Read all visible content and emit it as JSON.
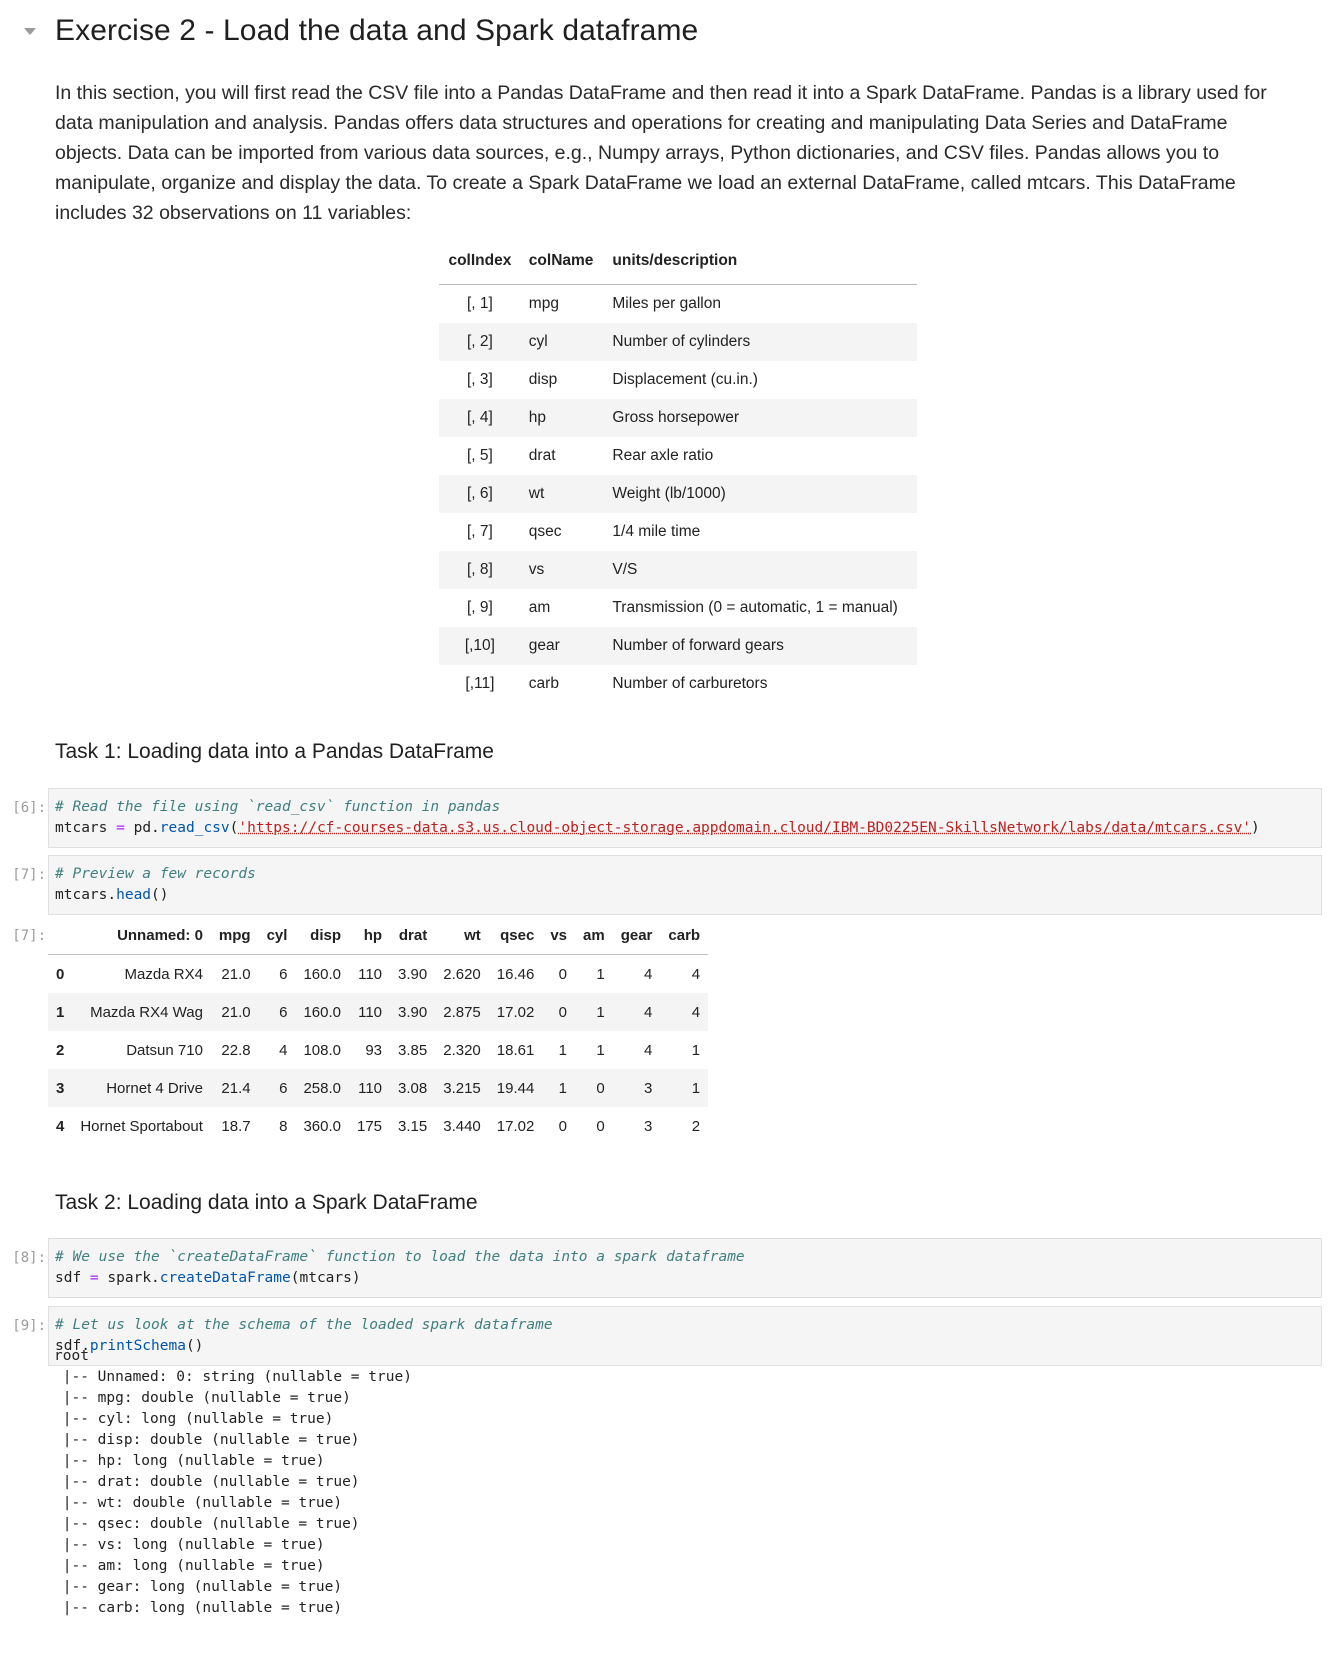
{
  "section": {
    "title": "Exercise 2 - Load the data and Spark dataframe",
    "intro": "In this section, you will first read the CSV file into a Pandas DataFrame and then read it into a Spark DataFrame. Pandas is a library used for data manipulation and analysis. Pandas offers data structures and operations for creating and manipulating Data Series and DataFrame objects. Data can be imported from various data sources, e.g., Numpy arrays, Python dictionaries, and CSV files. Pandas allows you to manipulate, organize and display the data. To create a Spark DataFrame we load an external DataFrame, called mtcars. This DataFrame includes 32 observations on 11 variables:"
  },
  "vars_table": {
    "headers": [
      "colIndex",
      "colName",
      "units/description"
    ],
    "rows": [
      [
        "[, 1]",
        "mpg",
        "Miles per gallon"
      ],
      [
        "[, 2]",
        "cyl",
        "Number of cylinders"
      ],
      [
        "[, 3]",
        "disp",
        "Displacement (cu.in.)"
      ],
      [
        "[, 4]",
        "hp",
        "Gross horsepower"
      ],
      [
        "[, 5]",
        "drat",
        "Rear axle ratio"
      ],
      [
        "[, 6]",
        "wt",
        "Weight (lb/1000)"
      ],
      [
        "[, 7]",
        "qsec",
        "1/4 mile time"
      ],
      [
        "[, 8]",
        "vs",
        "V/S"
      ],
      [
        "[, 9]",
        "am",
        "Transmission (0 = automatic, 1 = manual)"
      ],
      [
        "[,10]",
        "gear",
        "Number of forward gears"
      ],
      [
        "[,11]",
        "carb",
        "Number of carburetors"
      ]
    ]
  },
  "task1": {
    "title": "Task 1: Loading data into a Pandas DataFrame",
    "cell6": {
      "prompt": "[6]:",
      "comment": "# Read the file using `read_csv` function in pandas",
      "var": "mtcars",
      "op": " = ",
      "obj": "pd.",
      "fn": "read_csv",
      "open": "(",
      "url": "'https://cf-courses-data.s3.us.cloud-object-storage.appdomain.cloud/IBM-BD0225EN-SkillsNetwork/labs/data/mtcars.csv'",
      "close": ")"
    },
    "cell7": {
      "prompt": "[7]:",
      "comment": "# Preview a few records",
      "obj": "mtcars.",
      "fn": "head",
      "call": "()"
    },
    "output7": {
      "prompt": "[7]:",
      "headers": [
        "",
        "Unnamed: 0",
        "mpg",
        "cyl",
        "disp",
        "hp",
        "drat",
        "wt",
        "qsec",
        "vs",
        "am",
        "gear",
        "carb"
      ],
      "rows": [
        [
          "0",
          "Mazda RX4",
          "21.0",
          "6",
          "160.0",
          "110",
          "3.90",
          "2.620",
          "16.46",
          "0",
          "1",
          "4",
          "4"
        ],
        [
          "1",
          "Mazda RX4 Wag",
          "21.0",
          "6",
          "160.0",
          "110",
          "3.90",
          "2.875",
          "17.02",
          "0",
          "1",
          "4",
          "4"
        ],
        [
          "2",
          "Datsun 710",
          "22.8",
          "4",
          "108.0",
          "93",
          "3.85",
          "2.320",
          "18.61",
          "1",
          "1",
          "4",
          "1"
        ],
        [
          "3",
          "Hornet 4 Drive",
          "21.4",
          "6",
          "258.0",
          "110",
          "3.08",
          "3.215",
          "19.44",
          "1",
          "0",
          "3",
          "1"
        ],
        [
          "4",
          "Hornet Sportabout",
          "18.7",
          "8",
          "360.0",
          "175",
          "3.15",
          "3.440",
          "17.02",
          "0",
          "0",
          "3",
          "2"
        ]
      ]
    }
  },
  "task2": {
    "title": "Task 2: Loading data into a Spark DataFrame",
    "cell8": {
      "prompt": "[8]:",
      "comment": "# We use the `createDataFrame` function to load the data into a spark dataframe",
      "var": "sdf",
      "op": " = ",
      "obj": "spark.",
      "fn": "createDataFrame",
      "args": "(mtcars)"
    },
    "cell9": {
      "prompt": "[9]:",
      "comment": "# Let us look at the schema of the loaded spark dataframe",
      "obj": "sdf.",
      "fn": "printSchema",
      "call": "()"
    },
    "schema_output": [
      "root",
      " |-- Unnamed: 0: string (nullable = true)",
      " |-- mpg: double (nullable = true)",
      " |-- cyl: long (nullable = true)",
      " |-- disp: double (nullable = true)",
      " |-- hp: long (nullable = true)",
      " |-- drat: double (nullable = true)",
      " |-- wt: double (nullable = true)",
      " |-- qsec: double (nullable = true)",
      " |-- vs: long (nullable = true)",
      " |-- am: long (nullable = true)",
      " |-- gear: long (nullable = true)",
      " |-- carb: long (nullable = true)"
    ]
  }
}
